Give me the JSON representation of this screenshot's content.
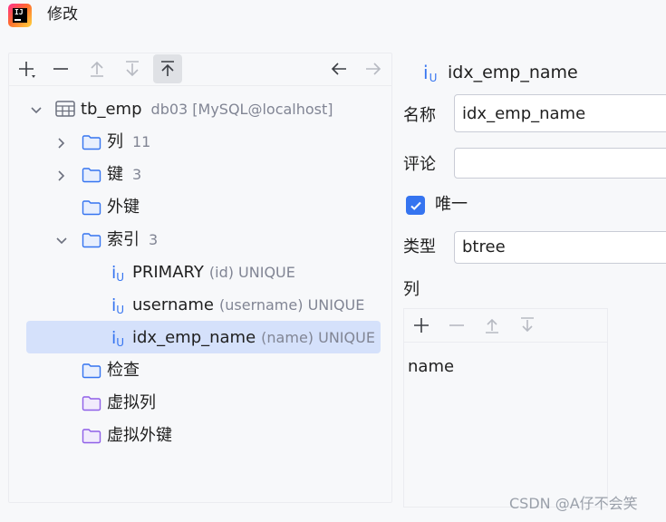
{
  "window": {
    "title": "修改",
    "logo": "intellij-logo"
  },
  "toolbar": {
    "buttons": [
      {
        "name": "add-button",
        "icon": "plus-icon"
      },
      {
        "name": "remove-button",
        "icon": "minus-icon"
      },
      {
        "name": "move-up-button",
        "icon": "arrow-up-icon"
      },
      {
        "name": "move-down-button",
        "icon": "arrow-down-icon"
      },
      {
        "name": "move-top-button",
        "icon": "arrow-to-top-icon"
      },
      {
        "name": "back-button",
        "icon": "arrow-left-icon"
      },
      {
        "name": "forward-button",
        "icon": "arrow-right-icon"
      }
    ]
  },
  "tree": {
    "table": {
      "label": "tb_emp",
      "hint": "db03 [MySQL@localhost]"
    },
    "columns": {
      "label": "列",
      "count": "11"
    },
    "keys": {
      "label": "键",
      "count": "3"
    },
    "foreign_keys": {
      "label": "外键"
    },
    "indexes": {
      "label": "索引",
      "count": "3"
    },
    "index_items": [
      {
        "name": "PRIMARY",
        "detail": "(id) UNIQUE"
      },
      {
        "name": "username",
        "detail": "(username) UNIQUE"
      },
      {
        "name": "idx_emp_name",
        "detail": "(name) UNIQUE"
      }
    ],
    "checks": {
      "label": "检查"
    },
    "virtual_columns": {
      "label": "虚拟列"
    },
    "virtual_foreign_keys": {
      "label": "虚拟外键"
    }
  },
  "editor": {
    "title": "idx_emp_name",
    "name_label": "名称",
    "name_value": "idx_emp_name",
    "comment_label": "评论",
    "comment_value": "",
    "unique_label": "唯一",
    "unique_checked": true,
    "type_label": "类型",
    "type_value": "btree",
    "columns_label": "列",
    "columns": [
      "name"
    ]
  },
  "watermark": "CSDN @A仔不会笑",
  "colors": {
    "accent": "#3574f0",
    "selected_row": "#d5e1fb",
    "folder_blue": "#3574f0",
    "folder_purple": "#8f5fe8"
  }
}
